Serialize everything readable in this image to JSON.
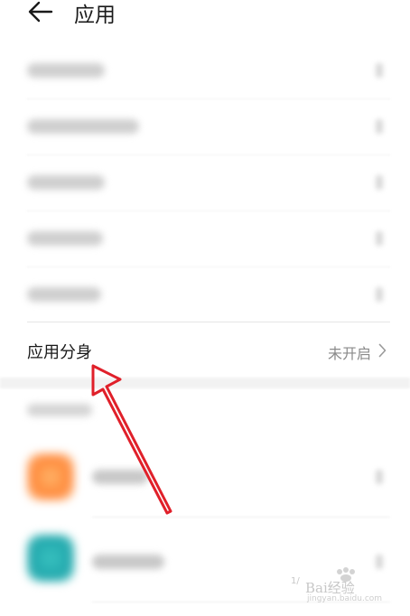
{
  "header": {
    "title": "应用"
  },
  "clone_row": {
    "label": "应用分身",
    "status": "未开启"
  },
  "watermark": {
    "text": "Bai经验",
    "sub": "jingyan.baidu.com",
    "page": "1/"
  },
  "colors": {
    "arrow": "#e0202a",
    "text_primary": "#1a1a1a",
    "text_secondary": "#8a8a8a"
  }
}
